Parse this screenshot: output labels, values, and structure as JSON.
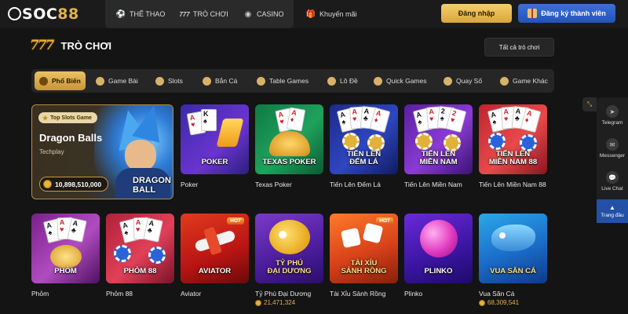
{
  "header": {
    "logo_prefix": "S",
    "logo_text": "OC",
    "logo_suffix": "88",
    "nav": [
      {
        "label": "THỂ THAO",
        "icon": "soccer-ball-icon"
      },
      {
        "label": "TRÒ CHƠI",
        "icon": "slot-777-icon"
      },
      {
        "label": "CASINO",
        "icon": "casino-chip-icon"
      }
    ],
    "promo": {
      "label": "Khuyến mãi",
      "icon": "gift-icon"
    },
    "login_label": "Đăng nhập",
    "register_label": "Đăng ký thành viên"
  },
  "section": {
    "icon_text": "777",
    "title": "TRÒ CHƠI",
    "all_games_label": "Tất cả trò chơi"
  },
  "tabs": [
    {
      "label": "Phổ Biến",
      "active": true
    },
    {
      "label": "Game Bài",
      "active": false
    },
    {
      "label": "Slots",
      "active": false
    },
    {
      "label": "Bắn Cá",
      "active": false
    },
    {
      "label": "Table Games",
      "active": false
    },
    {
      "label": "Lô Đề",
      "active": false
    },
    {
      "label": "Quick Games",
      "active": false
    },
    {
      "label": "Quay Số",
      "active": false
    },
    {
      "label": "Game Khác",
      "active": false
    }
  ],
  "featured": {
    "badge": "Top Slots Game",
    "title": "Dragon Balls",
    "provider": "Techplay",
    "jackpot": "10,898,510,000",
    "art_text": "DRAGON BALL"
  },
  "games_row1": [
    {
      "name": "Poker",
      "label": "POKER"
    },
    {
      "name": "Texas Poker",
      "label": "TEXAS POKER"
    },
    {
      "name": "Tiến Lên Đếm Lá",
      "label": "TIẾN LÊN\nĐẾM LÁ"
    },
    {
      "name": "Tiến Lên Miền Nam",
      "label": "TIẾN LÊN\nMIỀN NAM"
    },
    {
      "name": "Tiến Lên Miền Nam 88",
      "label": "TIẾN LÊN\nMIỀN NAM 88"
    }
  ],
  "games_row2": [
    {
      "name": "Phỏm",
      "label": "PHỎM",
      "hot": false,
      "jackpot": ""
    },
    {
      "name": "Phỏm 88",
      "label": "PHỎM 88",
      "hot": false,
      "jackpot": ""
    },
    {
      "name": "Aviator",
      "label": "AVIATOR",
      "hot": true,
      "jackpot": ""
    },
    {
      "name": "Tỷ Phú Đại Dương",
      "label": "TỶ PHÚ\nĐẠI DƯƠNG",
      "hot": false,
      "jackpot": "21,471,324"
    },
    {
      "name": "Tài Xỉu Sảnh Rồng",
      "label": "TÀI XỈU\nSẢNH RỒNG",
      "hot": true,
      "jackpot": ""
    },
    {
      "name": "Plinko",
      "label": "PLINKO",
      "hot": false,
      "jackpot": ""
    },
    {
      "name": "Vua Săn Cá",
      "label": "VUA SĂN CÁ",
      "hot": false,
      "jackpot": "68,309,541"
    }
  ],
  "hot_label": "HOT",
  "side_panel": [
    {
      "label": "Telegram",
      "icon": "telegram-icon"
    },
    {
      "label": "Messenger",
      "icon": "messenger-icon"
    },
    {
      "label": "Live Chat",
      "icon": "chat-icon"
    }
  ],
  "back_to_top_label": "Trang đầu",
  "colors": {
    "gold": "#e0b44e",
    "blue": "#2453b8",
    "background": "#141414"
  }
}
